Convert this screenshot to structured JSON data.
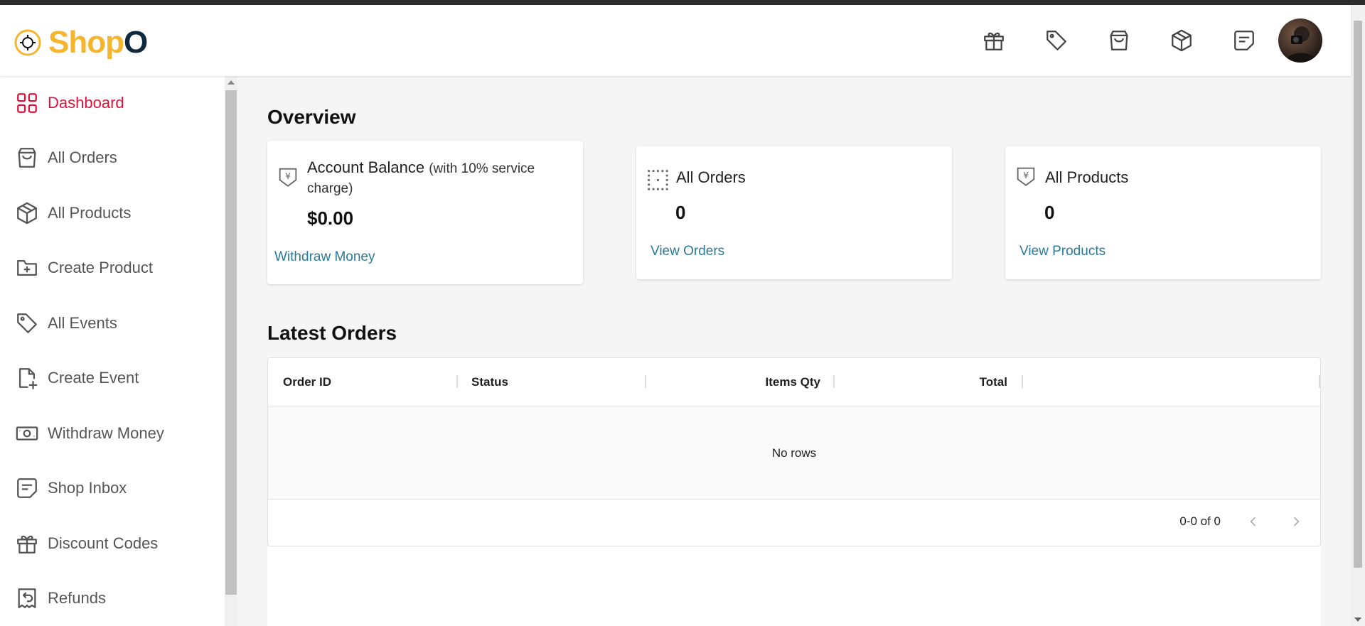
{
  "brand": {
    "part1": "Shop",
    "part2": "O"
  },
  "header": {
    "icons": [
      "gift-icon",
      "tag-icon",
      "shopping-bag-icon",
      "package-icon",
      "message-icon"
    ]
  },
  "sidebar": {
    "items": [
      {
        "label": "Dashboard",
        "icon": "dashboard-grid-icon",
        "active": true
      },
      {
        "label": "All Orders",
        "icon": "shopping-bag-icon"
      },
      {
        "label": "All Products",
        "icon": "package-icon"
      },
      {
        "label": "Create Product",
        "icon": "folder-plus-icon"
      },
      {
        "label": "All Events",
        "icon": "tag-icon"
      },
      {
        "label": "Create Event",
        "icon": "file-plus-icon"
      },
      {
        "label": "Withdraw Money",
        "icon": "cash-icon"
      },
      {
        "label": "Shop Inbox",
        "icon": "message-icon"
      },
      {
        "label": "Discount Codes",
        "icon": "gift-icon"
      },
      {
        "label": "Refunds",
        "icon": "receipt-refund-icon"
      }
    ]
  },
  "overview": {
    "title": "Overview",
    "balance_card": {
      "title": "Account Balance",
      "subtitle": "(with 10% service charge)",
      "value": "$0.00",
      "link": "Withdraw Money"
    },
    "orders_card": {
      "title": "All Orders",
      "value": "0",
      "link": "View Orders"
    },
    "products_card": {
      "title": "All Products",
      "value": "0",
      "link": "View Products"
    }
  },
  "latest_orders": {
    "title": "Latest Orders",
    "columns": [
      "Order ID",
      "Status",
      "Items Qty",
      "Total"
    ],
    "empty_text": "No rows",
    "pagination": "0-0 of 0"
  },
  "colors": {
    "accent": "#dc143c",
    "brand_yellow": "#f5b52e",
    "brand_dark": "#0f2a3f",
    "link": "#2a7a9a"
  }
}
